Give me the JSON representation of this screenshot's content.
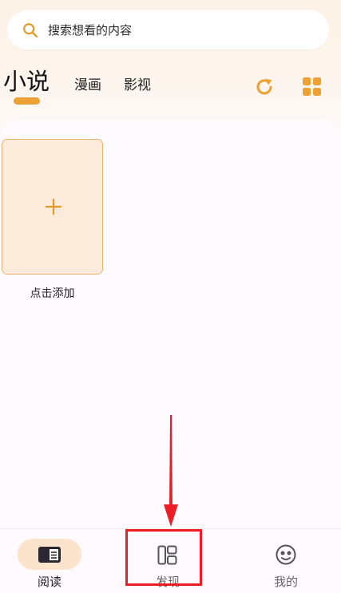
{
  "search": {
    "placeholder": "搜索想看的内容"
  },
  "tabs": [
    {
      "label": "小说",
      "active": true
    },
    {
      "label": "漫画",
      "active": false
    },
    {
      "label": "影视",
      "active": false
    }
  ],
  "header_icons": [
    "refresh-icon",
    "grid-icon"
  ],
  "library": {
    "add_label": "点击添加"
  },
  "bottom_nav": [
    {
      "label": "阅读",
      "icon": "book-icon",
      "active": true
    },
    {
      "label": "发现",
      "icon": "layout-icon",
      "active": false
    },
    {
      "label": "我的",
      "icon": "face-icon",
      "active": false
    }
  ],
  "colors": {
    "accent": "#eba134",
    "card_bg": "#fcebdb",
    "active_pill": "#fbe3cc",
    "annotation": "#ee1c24"
  }
}
